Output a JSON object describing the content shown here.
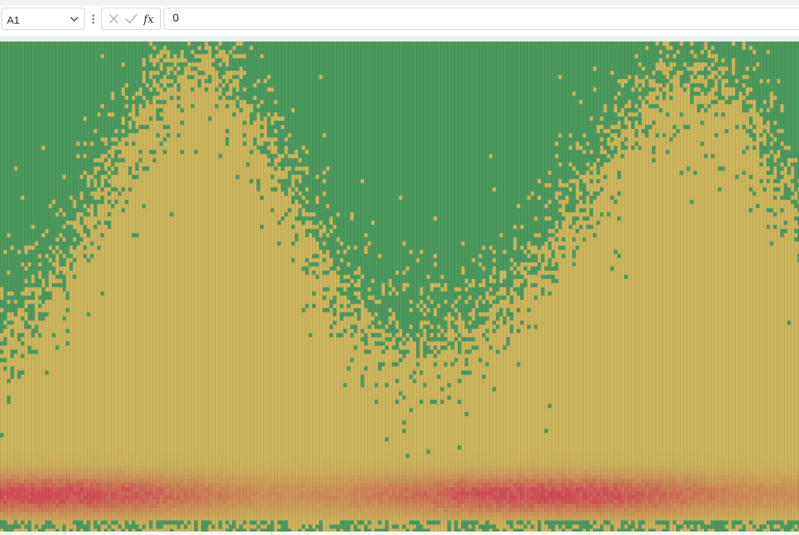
{
  "formula_bar": {
    "name_box": "A1",
    "formula_value": "0",
    "cancel_icon": "close-icon",
    "confirm_icon": "check-icon",
    "fx_label": "fx"
  },
  "sheet": {
    "conditional_format_colors": {
      "low": "#4c9a5f",
      "mid": "#cdb65d",
      "high": "#d04f55"
    }
  }
}
